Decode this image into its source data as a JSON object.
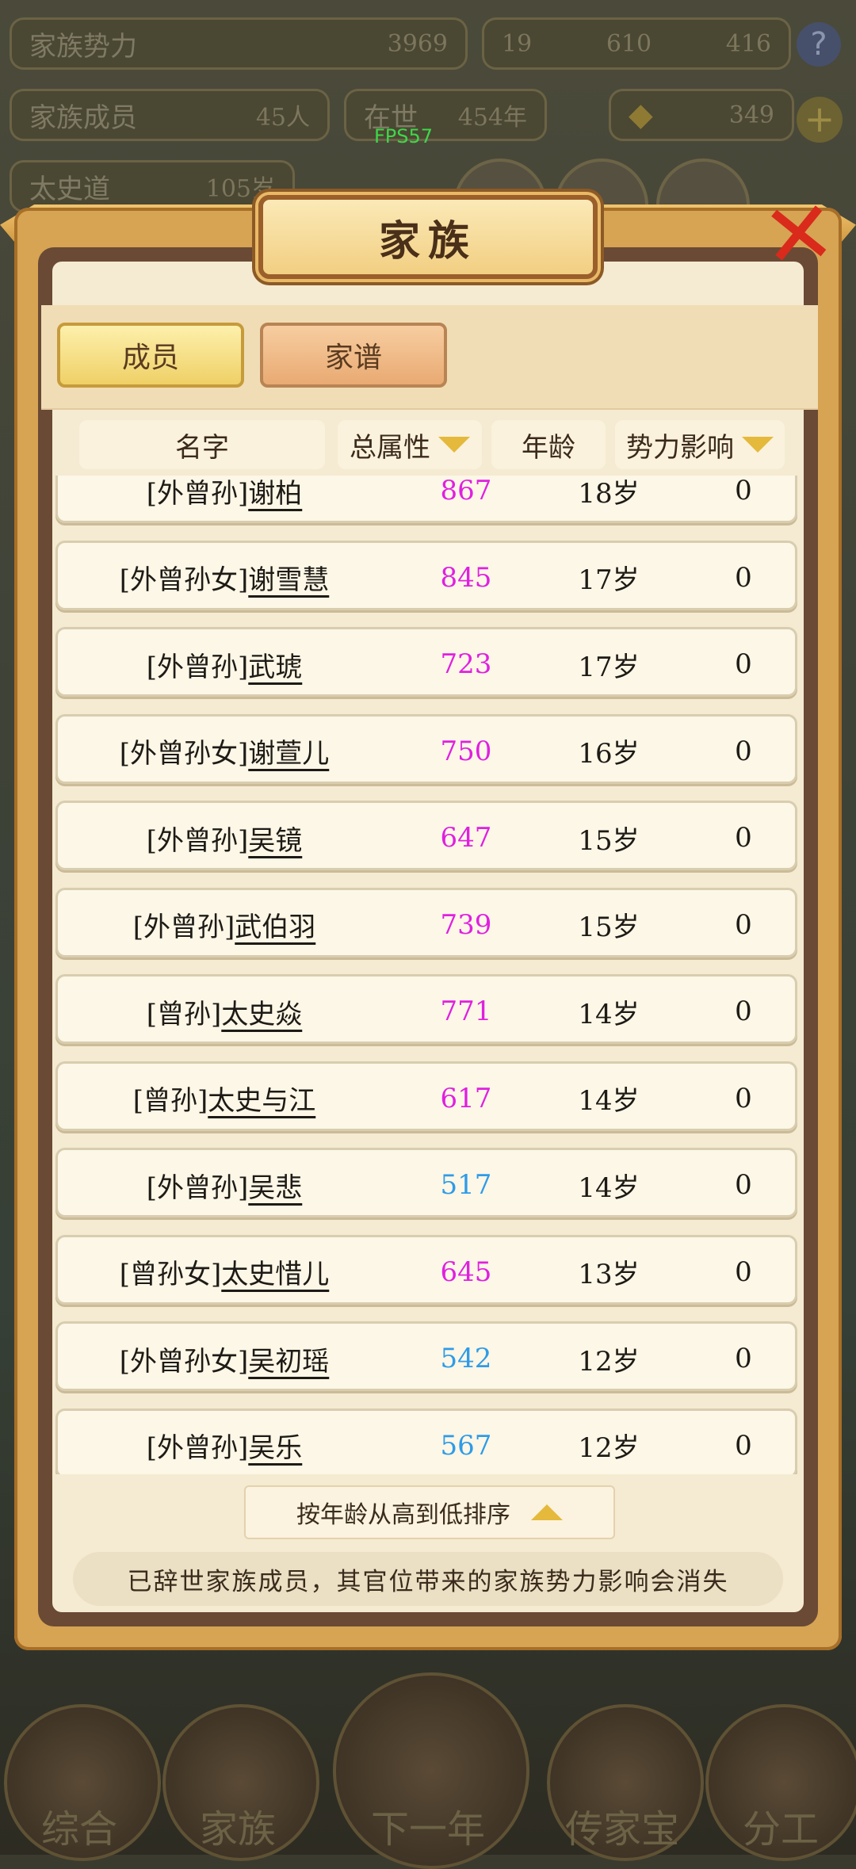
{
  "hud": {
    "clan_power_label": "家族势力",
    "clan_power_value": "3969",
    "members_label": "家族成员",
    "members_value": "45人",
    "alive_label": "在世",
    "alive_value": "454年",
    "ancestor_label": "太史道",
    "ancestor_value": "105岁",
    "res1": "19",
    "res2": "610",
    "res3": "416",
    "gold": "349",
    "fps": "FPS57"
  },
  "dialog": {
    "title": "家族",
    "close_icon": "close-x-icon"
  },
  "tabs": [
    {
      "label": "成员",
      "active": true
    },
    {
      "label": "家谱",
      "active": false
    }
  ],
  "table": {
    "headers": [
      "名字",
      "总属性",
      "年龄",
      "势力影响"
    ],
    "rows": [
      {
        "prefix": "[外曾孙]",
        "name": "谢柏",
        "attr": "867",
        "attr_color": "#e020e0",
        "age": "18岁",
        "influence": "0"
      },
      {
        "prefix": "[外曾孙女]",
        "name": "谢雪慧",
        "attr": "845",
        "attr_color": "#e020e0",
        "age": "17岁",
        "influence": "0"
      },
      {
        "prefix": "[外曾孙]",
        "name": "武琥",
        "attr": "723",
        "attr_color": "#e020e0",
        "age": "17岁",
        "influence": "0"
      },
      {
        "prefix": "[外曾孙女]",
        "name": "谢萱儿",
        "attr": "750",
        "attr_color": "#e020e0",
        "age": "16岁",
        "influence": "0"
      },
      {
        "prefix": "[外曾孙]",
        "name": "吴镜",
        "attr": "647",
        "attr_color": "#e020e0",
        "age": "15岁",
        "influence": "0"
      },
      {
        "prefix": "[外曾孙]",
        "name": "武伯羽",
        "attr": "739",
        "attr_color": "#e020e0",
        "age": "15岁",
        "influence": "0"
      },
      {
        "prefix": "[曾孙]",
        "name": "太史焱",
        "attr": "771",
        "attr_color": "#e020e0",
        "age": "14岁",
        "influence": "0"
      },
      {
        "prefix": "[曾孙]",
        "name": "太史与江",
        "attr": "617",
        "attr_color": "#e020e0",
        "age": "14岁",
        "influence": "0"
      },
      {
        "prefix": "[外曾孙]",
        "name": "吴悲",
        "attr": "517",
        "attr_color": "#2f9be8",
        "age": "14岁",
        "influence": "0"
      },
      {
        "prefix": "[曾孙女]",
        "name": "太史惜儿",
        "attr": "645",
        "attr_color": "#e020e0",
        "age": "13岁",
        "influence": "0"
      },
      {
        "prefix": "[外曾孙女]",
        "name": "吴初瑶",
        "attr": "542",
        "attr_color": "#2f9be8",
        "age": "12岁",
        "influence": "0"
      },
      {
        "prefix": "[外曾孙]",
        "name": "吴乐",
        "attr": "567",
        "attr_color": "#2f9be8",
        "age": "12岁",
        "influence": "0"
      }
    ]
  },
  "sort_button": "按年龄从高到低排序",
  "notice": "已辞世家族成员，其官位带来的家族势力影响会消失",
  "bottom_nav": [
    "综合",
    "家族",
    "下一年",
    "传家宝",
    "分工"
  ]
}
